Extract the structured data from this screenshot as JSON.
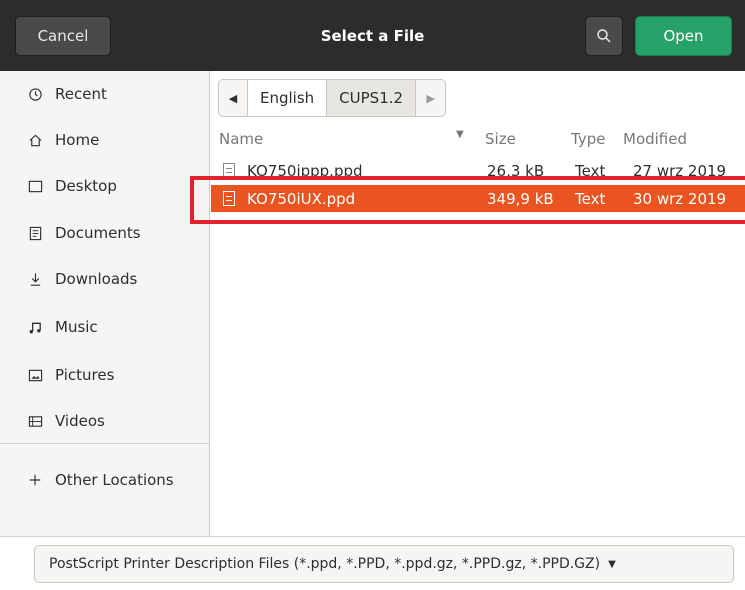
{
  "header": {
    "cancel_label": "Cancel",
    "title": "Select a File",
    "search_icon": "search-icon",
    "open_label": "Open"
  },
  "sidebar": {
    "items": [
      {
        "label": "Recent",
        "icon": "clock-icon"
      },
      {
        "label": "Home",
        "icon": "home-icon"
      },
      {
        "label": "Desktop",
        "icon": "desktop-icon"
      },
      {
        "label": "Documents",
        "icon": "documents-icon"
      },
      {
        "label": "Downloads",
        "icon": "download-icon"
      },
      {
        "label": "Music",
        "icon": "music-icon"
      },
      {
        "label": "Pictures",
        "icon": "pictures-icon"
      },
      {
        "label": "Videos",
        "icon": "videos-icon"
      },
      {
        "label": "Other Locations",
        "icon": "plus-icon"
      }
    ]
  },
  "pathbar": {
    "crumbs": [
      {
        "label": "English"
      },
      {
        "label": "CUPS1.2"
      }
    ]
  },
  "file_list": {
    "columns": {
      "name": "Name",
      "size": "Size",
      "type": "Type",
      "modified": "Modified"
    },
    "rows": [
      {
        "name": "KO750ippp.ppd",
        "size": "26,3 kB",
        "type": "Text",
        "modified": "27 wrz 2019"
      },
      {
        "name": "KO750iUX.ppd",
        "size": "349,9 kB",
        "type": "Text",
        "modified": "30 wrz 2019"
      }
    ]
  },
  "filter": {
    "selected": "PostScript Printer Description Files (*.ppd, *.PPD, *.ppd.gz, *.PPD.gz, *.PPD.GZ)"
  },
  "colors": {
    "header_bg": "#2c2c2c",
    "open_green": "#26a269",
    "selection_orange": "#e95420",
    "highlight_red": "#e0242e"
  }
}
